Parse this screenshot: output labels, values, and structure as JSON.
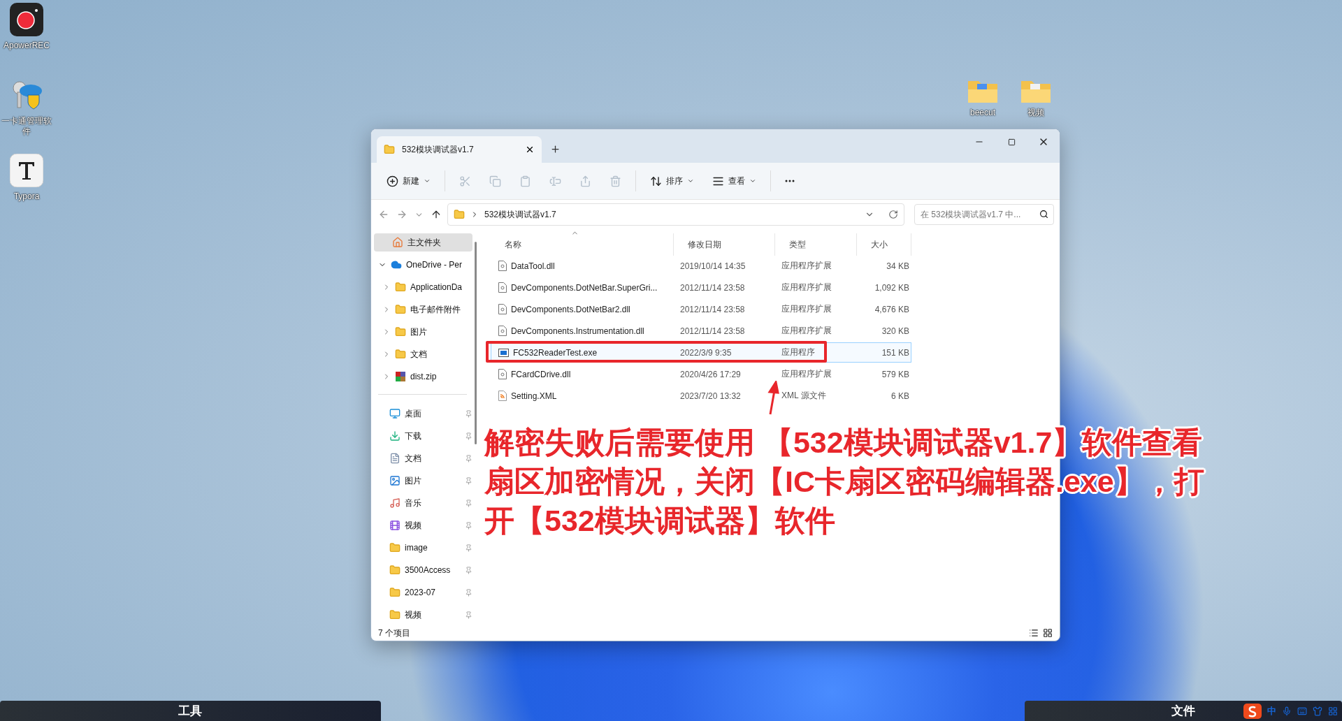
{
  "desktop_icons": [
    {
      "kind": "recorder",
      "label": "ApowerREC"
    },
    {
      "kind": "keys",
      "label": "一卡通管理软件"
    },
    {
      "kind": "typora",
      "label": "Typora"
    }
  ],
  "desktop_icons_right": [
    {
      "kind": "folder-blue",
      "label": "beecut"
    },
    {
      "kind": "folder-white",
      "label": "视频"
    }
  ],
  "window": {
    "tab_title": "532模块调试器v1.7",
    "toolbar": [
      {
        "kind": "new",
        "label": "新建",
        "disabled": false
      },
      {
        "kind": "cut",
        "disabled": true
      },
      {
        "kind": "copy",
        "disabled": true
      },
      {
        "kind": "paste",
        "disabled": true
      },
      {
        "kind": "rename",
        "disabled": true
      },
      {
        "kind": "share",
        "disabled": true
      },
      {
        "kind": "delete",
        "disabled": true
      },
      {
        "kind": "sort",
        "label": "排序",
        "disabled": false
      },
      {
        "kind": "view",
        "label": "查看",
        "disabled": false
      },
      {
        "kind": "more",
        "disabled": false
      }
    ],
    "address": "532模块调试器v1.7",
    "search": {
      "placeholder": "在 532模块调试器v1.7 中..."
    },
    "sidebar": {
      "home": {
        "label": "主文件夹",
        "selected": true
      },
      "onedrive": {
        "label": "OneDrive - Per",
        "expanded": true,
        "children": [
          {
            "kind": "folder",
            "label": "ApplicationDa"
          },
          {
            "kind": "folder",
            "label": "电子邮件附件"
          },
          {
            "kind": "folder",
            "label": "图片"
          },
          {
            "kind": "folder",
            "label": "文档"
          },
          {
            "kind": "zip",
            "label": "dist.zip"
          }
        ]
      },
      "quick_access": [
        {
          "kind": "desktop",
          "label": "桌面"
        },
        {
          "kind": "download",
          "label": "下载"
        },
        {
          "kind": "docs",
          "label": "文档"
        },
        {
          "kind": "pictures",
          "label": "图片"
        },
        {
          "kind": "music",
          "label": "音乐"
        },
        {
          "kind": "videos",
          "label": "视频"
        },
        {
          "kind": "folder",
          "label": "image"
        },
        {
          "kind": "folder",
          "label": "3500Access"
        },
        {
          "kind": "folder",
          "label": "2023-07"
        },
        {
          "kind": "folder",
          "label": "视频"
        }
      ]
    },
    "table": {
      "columns": [
        "名称",
        "修改日期",
        "类型",
        "大小"
      ],
      "rows": [
        {
          "kind": "dll",
          "name": "DataTool.dll",
          "modified": "2019/10/14 14:35",
          "type": "应用程序扩展",
          "size": "34 KB",
          "selected": false
        },
        {
          "kind": "dll",
          "name": "DevComponents.DotNetBar.SuperGri...",
          "modified": "2012/11/14 23:58",
          "type": "应用程序扩展",
          "size": "1,092 KB",
          "selected": false
        },
        {
          "kind": "dll",
          "name": "DevComponents.DotNetBar2.dll",
          "modified": "2012/11/14 23:58",
          "type": "应用程序扩展",
          "size": "4,676 KB",
          "selected": false
        },
        {
          "kind": "dll",
          "name": "DevComponents.Instrumentation.dll",
          "modified": "2012/11/14 23:58",
          "type": "应用程序扩展",
          "size": "320 KB",
          "selected": false
        },
        {
          "kind": "exe",
          "name": "FC532ReaderTest.exe",
          "modified": "2022/3/9 9:35",
          "type": "应用程序",
          "size": "151 KB",
          "selected": true
        },
        {
          "kind": "dll",
          "name": "FCardCDrive.dll",
          "modified": "2020/4/26 17:29",
          "type": "应用程序扩展",
          "size": "579 KB",
          "selected": false
        },
        {
          "kind": "xml",
          "name": "Setting.XML",
          "modified": "2023/7/20 13:32",
          "type": "XML 源文件",
          "size": "6 KB",
          "selected": false
        }
      ]
    },
    "status_bar": "7 个项目"
  },
  "annotation": "解密失败后需要使用 【532模块调试器v1.7】软件查看扇区加密情况，关闭【IC卡扇区密码编辑器.exe】，打开【532模块调试器】软件",
  "taskbar": {
    "left": "工具",
    "right": "文件",
    "ime": "中"
  }
}
